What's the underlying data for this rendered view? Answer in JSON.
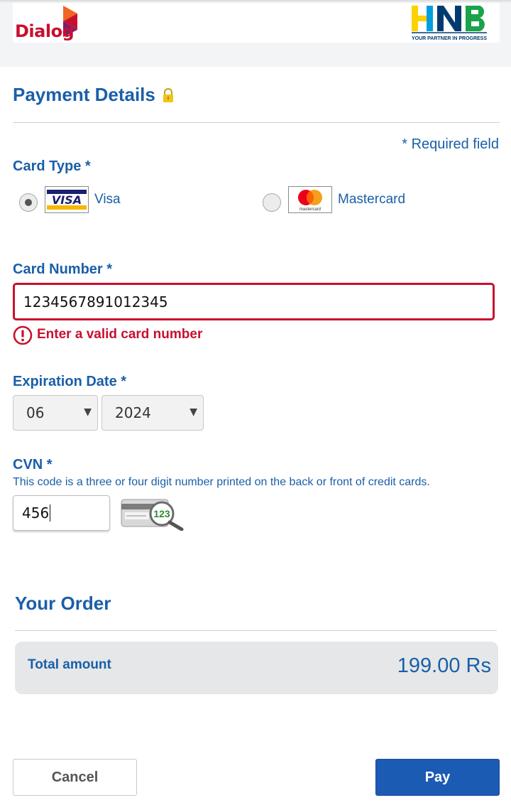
{
  "header": {
    "left_logo": "Dialog",
    "right_logo": "HNB",
    "right_logo_tagline": "YOUR PARTNER IN PROGRESS"
  },
  "payment": {
    "title": "Payment Details",
    "lock_icon": "lock-icon",
    "required_note": "* Required field",
    "card_type_label": "Card Type *",
    "card_types": [
      {
        "name": "Visa",
        "logo_text": "VISA",
        "selected": true
      },
      {
        "name": "Mastercard",
        "logo_text": "mastercard",
        "selected": false
      }
    ],
    "card_number_label": "Card Number *",
    "card_number_value": "1234567891012345",
    "card_number_error": "Enter a valid card number",
    "expiration_label": "Expiration Date *",
    "expiration_month": "06",
    "expiration_year": "2024",
    "cvn_label": "CVN *",
    "cvn_help": "This code is a three or four digit number printed on the back or front of credit cards.",
    "cvn_value": "456",
    "cvn_image_text": "123"
  },
  "order": {
    "title": "Your Order",
    "total_label": "Total amount",
    "total_value": "199.00 Rs"
  },
  "actions": {
    "cancel_label": "Cancel",
    "pay_label": "Pay"
  },
  "colors": {
    "primary_text": "#1a5fa8",
    "error": "#c8102e",
    "pay_button": "#1c5bb4"
  }
}
